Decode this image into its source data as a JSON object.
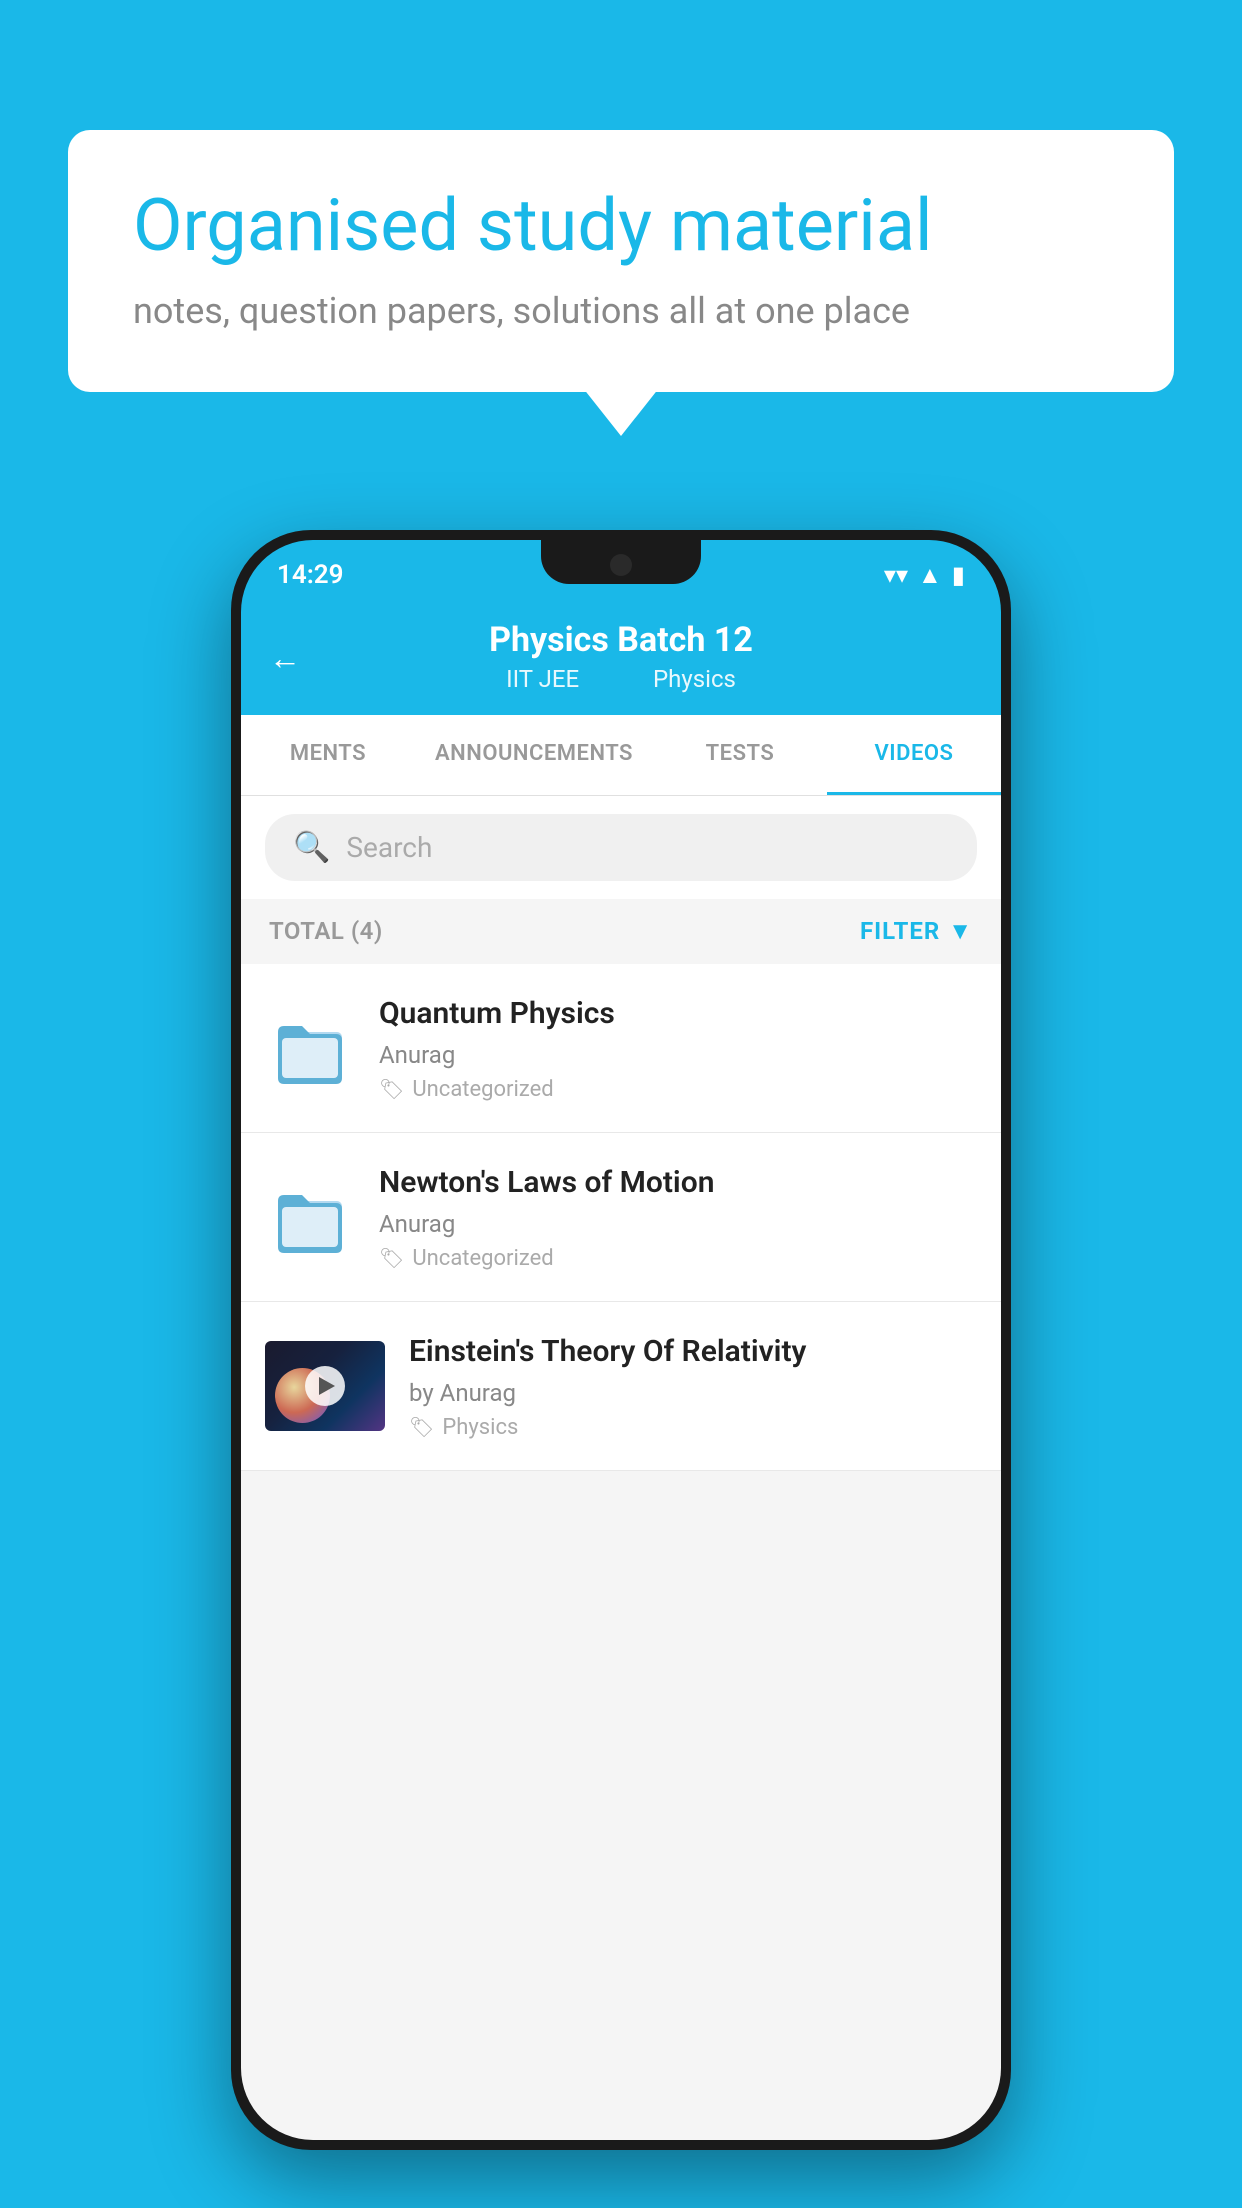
{
  "background_color": "#1ab8e8",
  "speech_bubble": {
    "title": "Organised study material",
    "subtitle": "notes, question papers, solutions all at one place"
  },
  "phone": {
    "status_bar": {
      "time": "14:29",
      "wifi": "▼",
      "signal": "▲",
      "battery": "▮"
    },
    "header": {
      "back_label": "←",
      "title": "Physics Batch 12",
      "subtitle_part1": "IIT JEE",
      "subtitle_part2": "Physics"
    },
    "tabs": [
      {
        "label": "MENTS",
        "active": false
      },
      {
        "label": "ANNOUNCEMENTS",
        "active": false
      },
      {
        "label": "TESTS",
        "active": false
      },
      {
        "label": "VIDEOS",
        "active": true
      }
    ],
    "search": {
      "placeholder": "Search"
    },
    "filter": {
      "total_label": "TOTAL (4)",
      "filter_label": "FILTER"
    },
    "videos": [
      {
        "id": 1,
        "title": "Quantum Physics",
        "author": "Anurag",
        "tag": "Uncategorized",
        "has_thumb": false
      },
      {
        "id": 2,
        "title": "Newton's Laws of Motion",
        "author": "Anurag",
        "tag": "Uncategorized",
        "has_thumb": false
      },
      {
        "id": 3,
        "title": "Einstein's Theory Of Relativity",
        "author": "by Anurag",
        "tag": "Physics",
        "has_thumb": true
      }
    ]
  }
}
